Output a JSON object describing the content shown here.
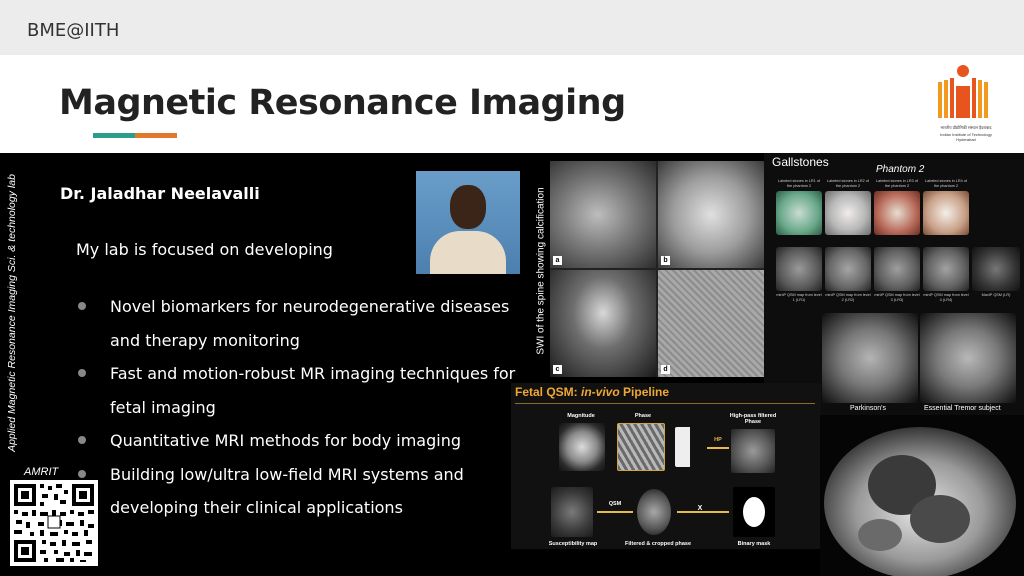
{
  "header": {
    "org": "BME@IITH"
  },
  "title": "Magnetic Resonance Imaging",
  "accent_colors": [
    "#2a9d8f",
    "#e07a2a"
  ],
  "logo": {
    "name": "iith-logo",
    "caption_lines": [
      "भारतीय प्रौद्योगिकी संस्थान हैदराबाद",
      "Indian Institute of Technology Hyderabad"
    ]
  },
  "sidebar_label": "Applied Magnetic Resonance Imaging Sci. & technology lab",
  "profile": {
    "name": "Dr.  Jaladhar Neelavalli",
    "intro": "My lab is focused on developing",
    "bullets": [
      "Novel biomarkers for neurodegenerative diseases and therapy monitoring",
      "Fast and motion-robust MR imaging techniques for fetal imaging",
      "Quantitative MRI methods for body imaging",
      "Building low/ultra low-field MRI systems and developing their clinical applications"
    ]
  },
  "qr": {
    "label": "AMRIT"
  },
  "spine_figure": {
    "caption": "SWI of the spine showing calcification",
    "panel_labels": [
      "a",
      "b",
      "c",
      "d"
    ]
  },
  "gallstones_figure": {
    "title": "Gallstones",
    "subtitle": "Phantom 2",
    "top_captions": [
      "Labeled stones in LR1 of the phantom 2",
      "Labeled stones in LR2 of the phantom 2",
      "Labeled stones in LR3 of the phantom 2",
      "Labeled stones in LR4 of the phantom 2"
    ],
    "map_captions": [
      "minIP QSM map from level 1 (LR1)",
      "minIP QSM map from level 2 (LR2)",
      "minIP QSM map from level 3 (LR3)",
      "minIP QSM map from level 4 (LR4)",
      "MaxIP QSM (LR)"
    ]
  },
  "brain_figure": {
    "labels": [
      "Parkinson's",
      "Essential Tremor subject"
    ]
  },
  "fetal_figure": {
    "title_prefix": "Fetal QSM: ",
    "title_italic": "in-vivo",
    "title_suffix": " Pipeline",
    "labels": {
      "magnitude": "Magnitude",
      "phase": "Phase",
      "highpass": "High-pass filtered Phase",
      "hp": "HP",
      "qsm": "QSM",
      "x": "X",
      "susceptibility": "Susceptibility map",
      "filtered": "Filtered  & cropped phase",
      "mask": "Binary mask"
    }
  }
}
